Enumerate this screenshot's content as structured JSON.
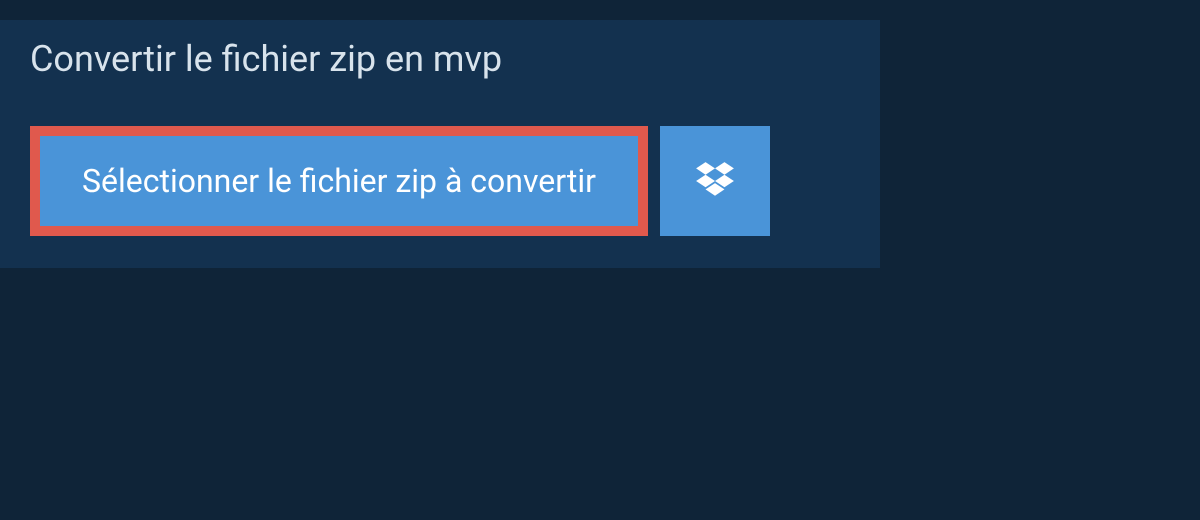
{
  "header": {
    "title": "Convertir le fichier zip en mvp"
  },
  "actions": {
    "select_file_label": "Sélectionner le fichier zip à convertir"
  }
}
